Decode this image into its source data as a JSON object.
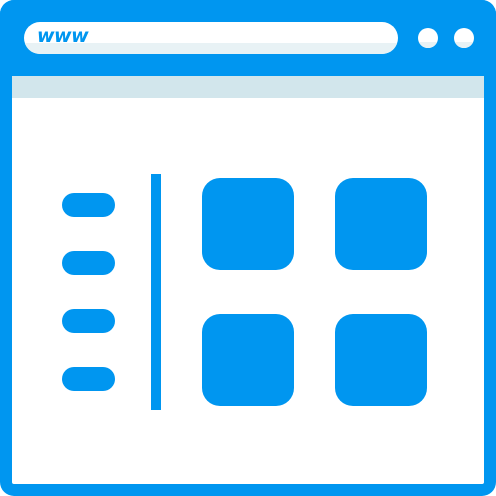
{
  "browser": {
    "address_text": "www",
    "window_controls": [
      "dot-1",
      "dot-2"
    ]
  },
  "colors": {
    "accent": "#0096f0",
    "light_panel": "#e4f1f4",
    "strip": "#d2e6ec",
    "white": "#ffffff"
  },
  "sidebar": {
    "menu_line_count": 4
  },
  "grid": {
    "tile_count": 4
  }
}
